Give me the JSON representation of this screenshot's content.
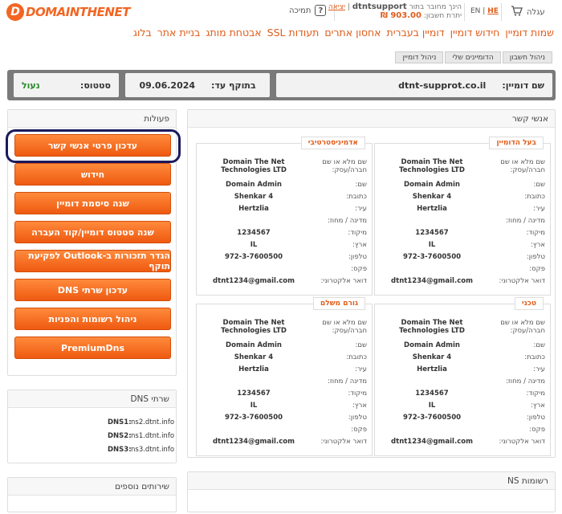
{
  "header": {
    "logo_text": "DOMAINTHENET",
    "help_label": "תמיכה",
    "account": {
      "logged_as": "הינך מחובר בתור",
      "username": "dtntsupport",
      "logout": "יציאה",
      "balance_label": "יתרת חשבון:",
      "balance_value": "903.00 ₪"
    },
    "lang": {
      "en": "EN",
      "sep": "|",
      "he": "HE"
    },
    "cart_label": "עגלה"
  },
  "nav": [
    "שמות דומיין",
    "חידוש דומיין",
    "דומיין בעברית",
    "אחסון אתרים",
    "תעודות SSL",
    "אבטחת מותג",
    "בניית אתר",
    "בלוג"
  ],
  "breadcrumb": [
    "ניהול חשבון",
    "הדומיינים שלי",
    "ניהול דומיין"
  ],
  "domain_bar": {
    "name_label": "שם דומיין:",
    "name_value": "dtnt-supprot.co.il",
    "expiry_label": "בתוקף עד:",
    "expiry_value": "09.06.2024",
    "status_label": "סטטוס:",
    "status_value": "נעול"
  },
  "actions": {
    "title": "פעולות",
    "buttons": [
      "עדכון פרטי אנשי קשר",
      "חידוש",
      "שנה סיסמת דומיין",
      "שנה סטטוס דומיין/קוד העברה",
      "הגדר תזכורות ב-Outlook לפקיעת תוקף",
      "עדכון שרתי DNS",
      "ניהול רשומות והפניות",
      "PremiumDns"
    ]
  },
  "dns": {
    "title": "שרתי DNS",
    "rows": [
      {
        "k": "DNS1:",
        "v": "ns2.dtnt.info"
      },
      {
        "k": "DNS2:",
        "v": "ns1.dtnt.info"
      },
      {
        "k": "DNS3:",
        "v": "ns3.dtnt.info"
      }
    ]
  },
  "extra": {
    "title": "שירותים נוספים"
  },
  "contacts": {
    "title": "אנשי קשר",
    "labels": [
      "שם מלא או שם חברה/עסק:",
      "שם:",
      "כתובת:",
      "עיר:",
      "מדינה / מחוז:",
      "מיקוד:",
      "ארץ:",
      "טלפון:",
      "פקס:",
      "דואר אלקטרוני:"
    ],
    "cards": [
      {
        "tag": "בעל הדומיין",
        "values": [
          "Domain The Net Technologies LTD",
          "Domain Admin",
          "Shenkar 4",
          "Hertzlia",
          "",
          "1234567",
          "IL",
          "972-3-7600500",
          "",
          "dtnt1234@gmail.com"
        ]
      },
      {
        "tag": "אדמיניסטרטיבי",
        "values": [
          "Domain The Net Technologies LTD",
          "Domain Admin",
          "Shenkar 4",
          "Hertzlia",
          "",
          "1234567",
          "IL",
          "972-3-7600500",
          "",
          "dtnt1234@gmail.com"
        ]
      },
      {
        "tag": "טכני",
        "values": [
          "Domain The Net Technologies LTD",
          "Domain Admin",
          "Shenkar 4",
          "Hertzlia",
          "",
          "1234567",
          "IL",
          "972-3-7600500",
          "",
          "dtnt1234@gmail.com"
        ]
      },
      {
        "tag": "גורם משלם",
        "values": [
          "Domain The Net Technologies LTD",
          "Domain Admin",
          "Shenkar 4",
          "Hertzlia",
          "",
          "1234567",
          "IL",
          "972-3-7600500",
          "",
          "dtnt1234@gmail.com"
        ]
      }
    ]
  },
  "ns_records": {
    "title": "רשומות NS"
  }
}
